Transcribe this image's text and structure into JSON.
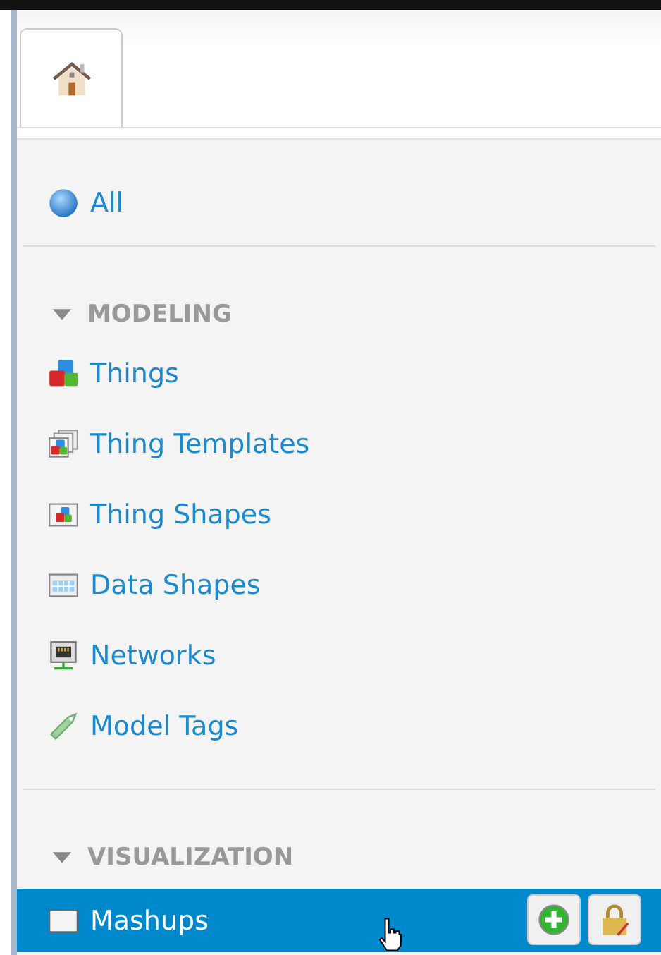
{
  "tabs": [
    {
      "kind": "home",
      "selected": true
    }
  ],
  "all_item": {
    "label": "All",
    "selected": false
  },
  "sections": [
    {
      "title": "MODELING",
      "expanded": true,
      "items": [
        {
          "kind": "things",
          "label": "Things",
          "selected": false
        },
        {
          "kind": "templates",
          "label": "Thing Templates",
          "selected": false
        },
        {
          "kind": "shapes",
          "label": "Thing Shapes",
          "selected": false
        },
        {
          "kind": "datashapes",
          "label": "Data Shapes",
          "selected": false
        },
        {
          "kind": "networks",
          "label": "Networks",
          "selected": false
        },
        {
          "kind": "tags",
          "label": "Model Tags",
          "selected": false
        }
      ]
    },
    {
      "title": "VISUALIZATION",
      "expanded": true,
      "items": [
        {
          "kind": "mashups",
          "label": "Mashups",
          "selected": true
        }
      ]
    }
  ]
}
